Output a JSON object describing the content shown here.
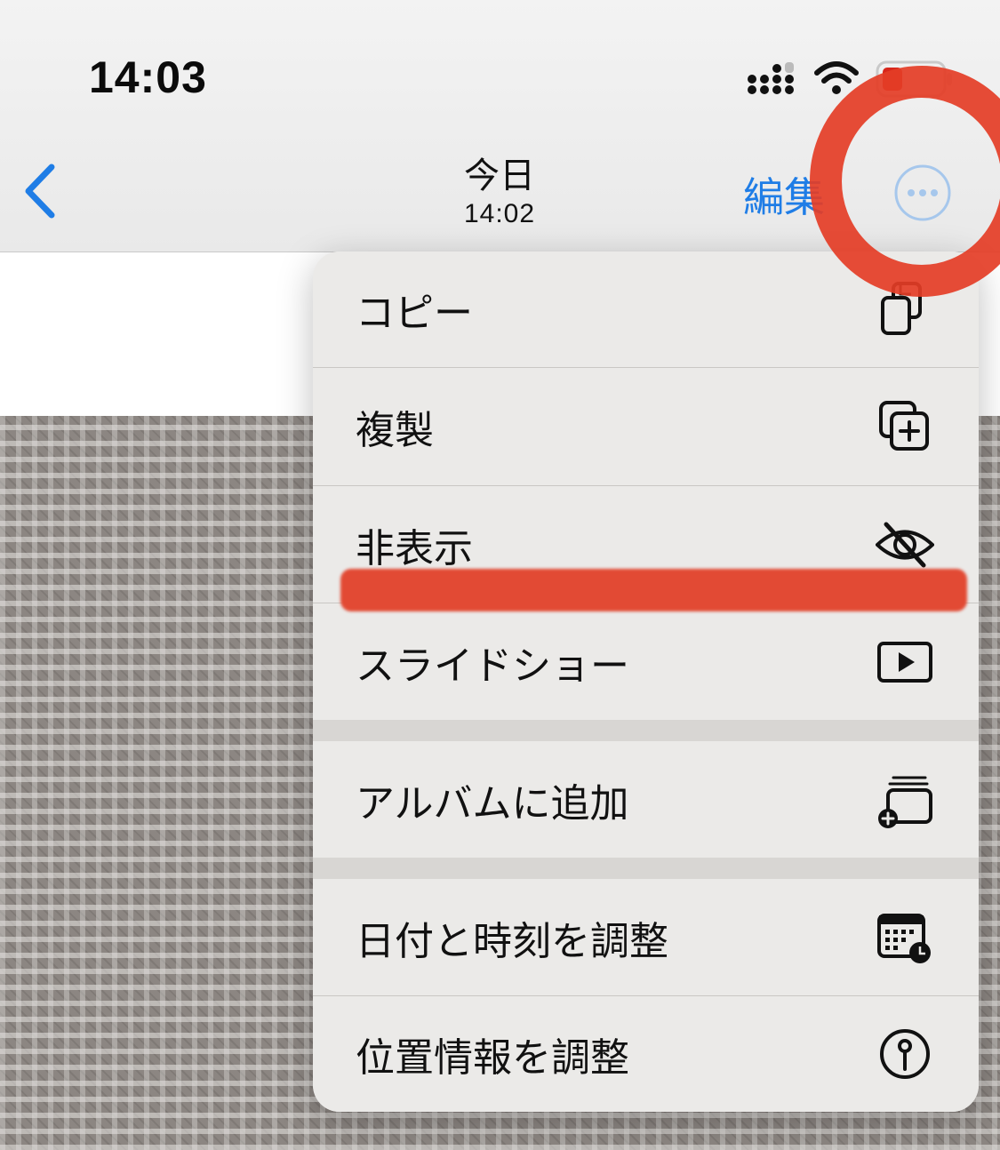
{
  "status_bar": {
    "time": "14:03"
  },
  "nav": {
    "title": "今日",
    "subtitle": "14:02",
    "edit_label": "編集"
  },
  "menu": {
    "items": [
      {
        "label": "コピー",
        "icon": "copy-icon"
      },
      {
        "label": "複製",
        "icon": "duplicate-icon"
      },
      {
        "label": "非表示",
        "icon": "eye-slash-icon"
      },
      {
        "label": "スライドショー",
        "icon": "play-rectangle-icon"
      },
      {
        "label": "アルバムに追加",
        "icon": "add-to-album-icon"
      },
      {
        "label": "日付と時刻を調整",
        "icon": "calendar-clock-icon"
      },
      {
        "label": "位置情報を調整",
        "icon": "location-pin-icon"
      }
    ]
  },
  "colors": {
    "accent": "#1f7de6",
    "annotation_red": "#e24a34",
    "menu_bg": "#ebeae8"
  }
}
